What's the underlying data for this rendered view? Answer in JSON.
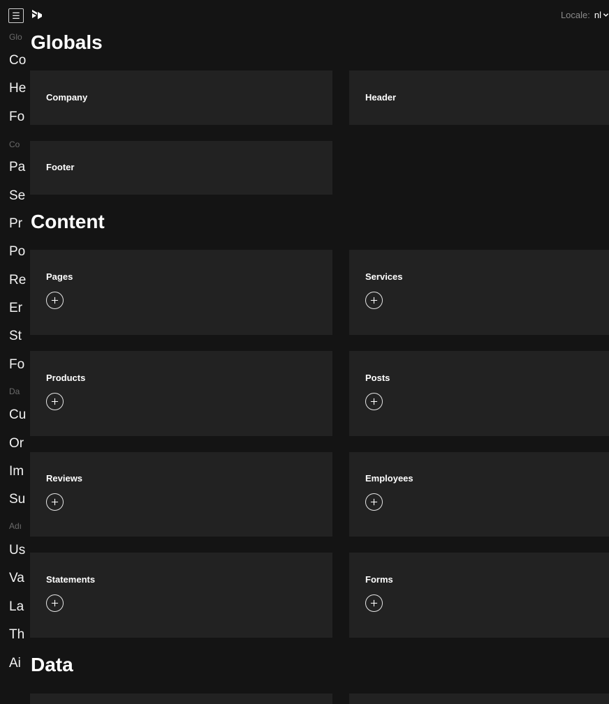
{
  "topbar": {
    "menu_icon_glyph": "☰",
    "locale_label": "Locale:",
    "locale_value": "nl"
  },
  "sidebar": {
    "items": [
      {
        "type": "group",
        "label": "Glo"
      },
      {
        "type": "link",
        "label": "Co"
      },
      {
        "type": "link",
        "label": "He"
      },
      {
        "type": "link",
        "label": "Fo"
      },
      {
        "type": "group",
        "label": "Co"
      },
      {
        "type": "link",
        "label": "Pa"
      },
      {
        "type": "link",
        "label": "Se"
      },
      {
        "type": "link",
        "label": "Pr"
      },
      {
        "type": "link",
        "label": "Po"
      },
      {
        "type": "link",
        "label": "Re"
      },
      {
        "type": "link",
        "label": "Er"
      },
      {
        "type": "link",
        "label": "St"
      },
      {
        "type": "link",
        "label": "Fo"
      },
      {
        "type": "group",
        "label": "Da"
      },
      {
        "type": "link",
        "label": "Cu"
      },
      {
        "type": "link",
        "label": "Or"
      },
      {
        "type": "link",
        "label": "Im"
      },
      {
        "type": "link",
        "label": "Su"
      },
      {
        "type": "group",
        "label": "Adı"
      },
      {
        "type": "link",
        "label": "Us"
      },
      {
        "type": "link",
        "label": "Va"
      },
      {
        "type": "link",
        "label": "La"
      },
      {
        "type": "link",
        "label": "Th"
      },
      {
        "type": "link",
        "label": "Ai"
      }
    ]
  },
  "sections": {
    "globals": {
      "title": "Globals",
      "cards": [
        "Company",
        "Header",
        "Footer"
      ]
    },
    "content": {
      "title": "Content",
      "cards": [
        "Pages",
        "Services",
        "Products",
        "Posts",
        "Reviews",
        "Employees",
        "Statements",
        "Forms"
      ]
    },
    "data": {
      "title": "Data"
    }
  },
  "colors": {
    "background": "#141414",
    "card": "#222222",
    "text": "#ffffff",
    "muted": "#6b6b6b"
  }
}
